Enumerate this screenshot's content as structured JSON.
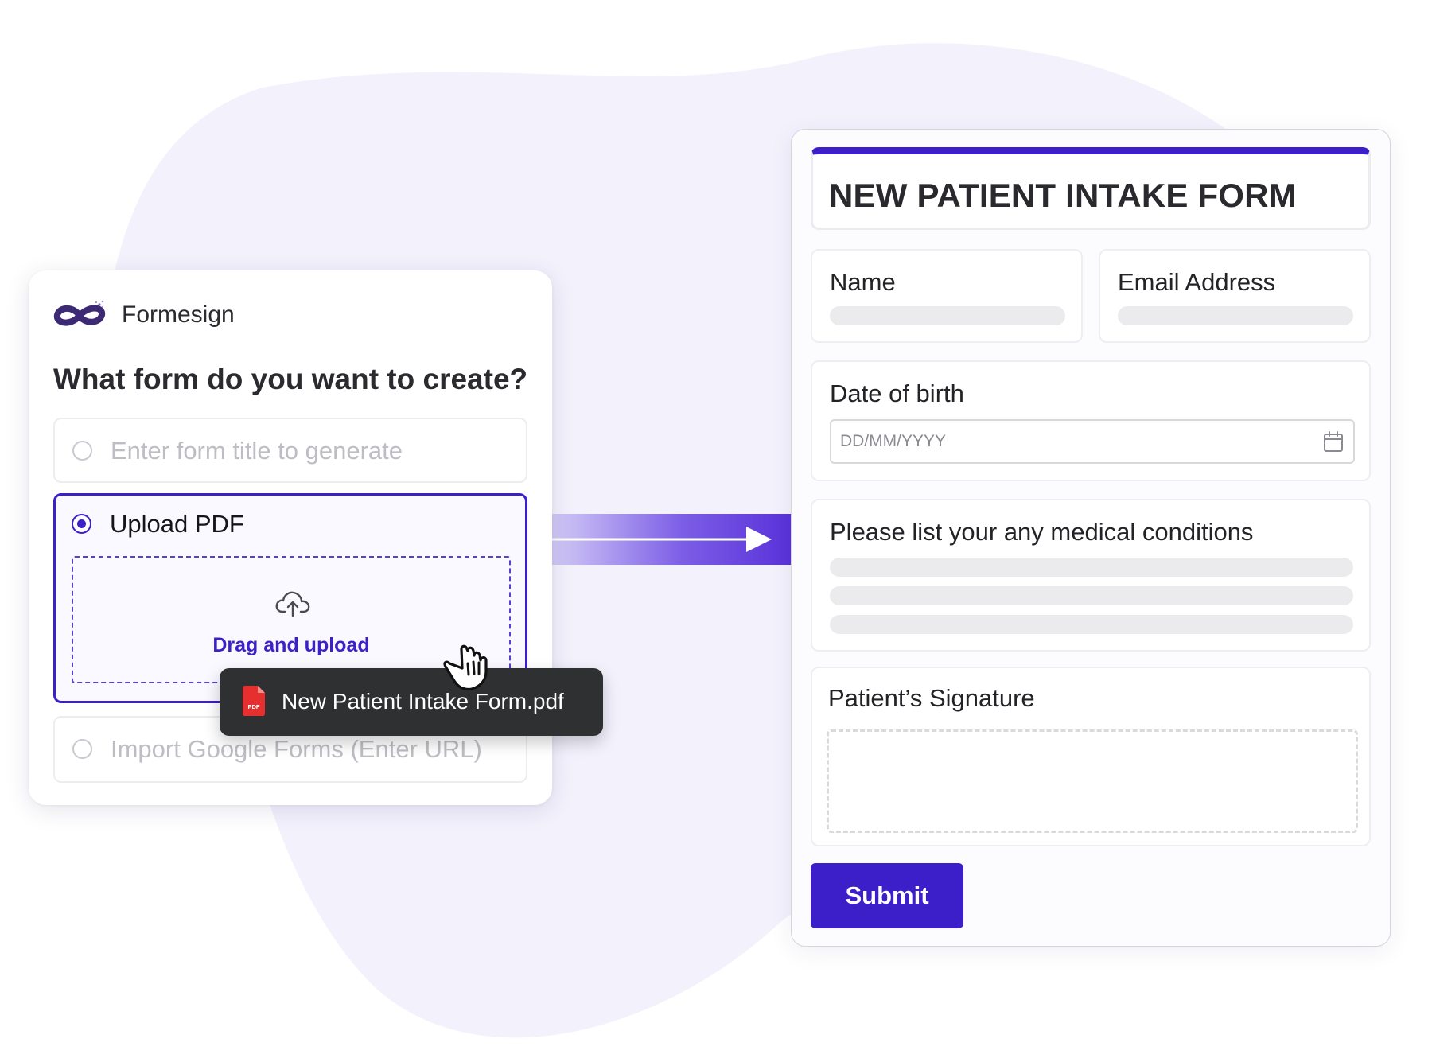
{
  "left_card": {
    "brand_name": "Formesign",
    "question": "What form do you want to create?",
    "options": [
      {
        "label": "Enter form title to generate",
        "selected": false
      },
      {
        "label": "Upload PDF",
        "selected": true
      },
      {
        "label": "Import Google Forms (Enter URL)",
        "selected": false
      }
    ],
    "dropzone": {
      "label": "Drag and upload",
      "icon": "cloud-upload-icon"
    }
  },
  "file_chip": {
    "file_name": "New Patient Intake Form.pdf",
    "icon": "pdf-file-icon",
    "icon_text": "PDF"
  },
  "right_card": {
    "title": "NEW PATIENT INTAKE FORM",
    "fields": {
      "name": "Name",
      "email": "Email Address",
      "dob": "Date of birth",
      "dob_placeholder": "DD/MM/YYYY",
      "medical": "Please list your any medical conditions",
      "signature": "Patient’s Signature"
    },
    "submit_label": "Submit"
  },
  "colors": {
    "accent": "#3d1fc9",
    "background_blob": "#f3f1fc",
    "tooltip": "#2f3031"
  }
}
